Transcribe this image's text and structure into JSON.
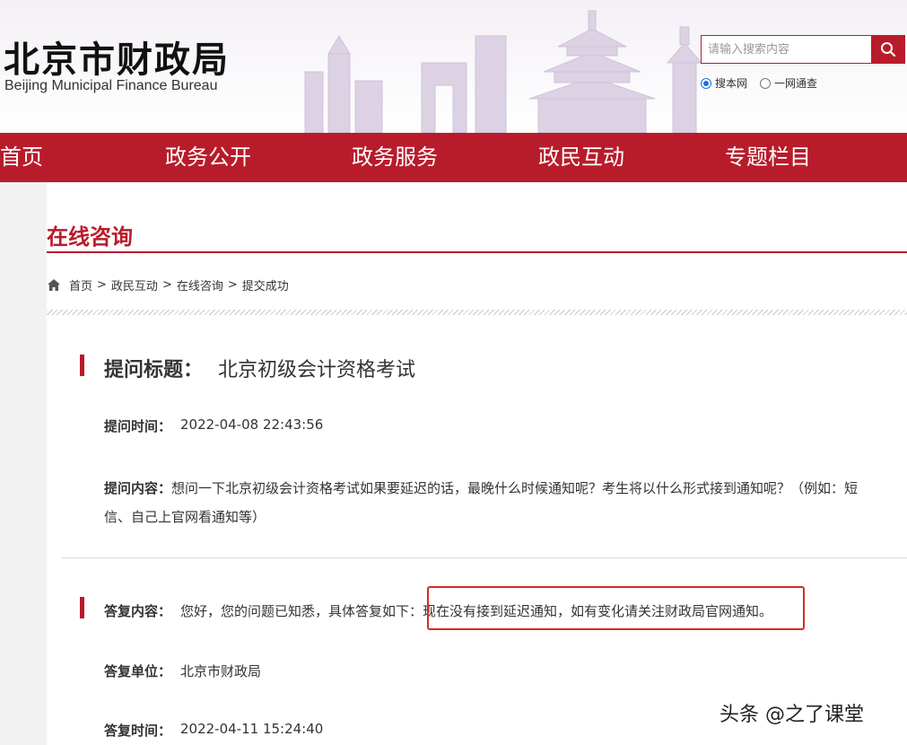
{
  "header": {
    "title": "北京市财政局",
    "subtitle": "Beijing Municipal Finance Bureau",
    "search": {
      "placeholder": "请输入搜索内容",
      "options": [
        {
          "label": "搜本网",
          "selected": true
        },
        {
          "label": "一网通查",
          "selected": false
        }
      ]
    }
  },
  "nav": {
    "items": [
      {
        "label": "首页"
      },
      {
        "label": "政务公开"
      },
      {
        "label": "政务服务"
      },
      {
        "label": "政民互动"
      },
      {
        "label": "专题栏目"
      }
    ]
  },
  "section": {
    "title": "在线咨询"
  },
  "breadcrumb": {
    "items": [
      "首页",
      "政民互动",
      "在线咨询",
      "提交成功"
    ],
    "separator": ">"
  },
  "question": {
    "title_label": "提问标题：",
    "title": "北京初级会计资格考试",
    "time_label": "提问时间：",
    "time": "2022-04-08 22:43:56",
    "content_label": "提问内容：",
    "content": "想问一下北京初级会计资格考试如果要延迟的话，最晚什么时候通知呢？考生将以什么形式接到通知呢？（例如：短信、自己上官网看通知等）"
  },
  "reply": {
    "content_label": "答复内容：",
    "content": "您好，您的问题已知悉，具体答复如下：现在没有接到延迟通知，如有变化请关注财政局官网通知。",
    "unit_label": "答复单位：",
    "unit": "北京市财政局",
    "time_label": "答复时间：",
    "time": "2022-04-11 15:24:40"
  },
  "watermark": "头条 @之了课堂",
  "colors": {
    "brand_red": "#b81c2b",
    "highlight_box": "#d62a2a",
    "radio_blue": "#1e6fd9"
  }
}
